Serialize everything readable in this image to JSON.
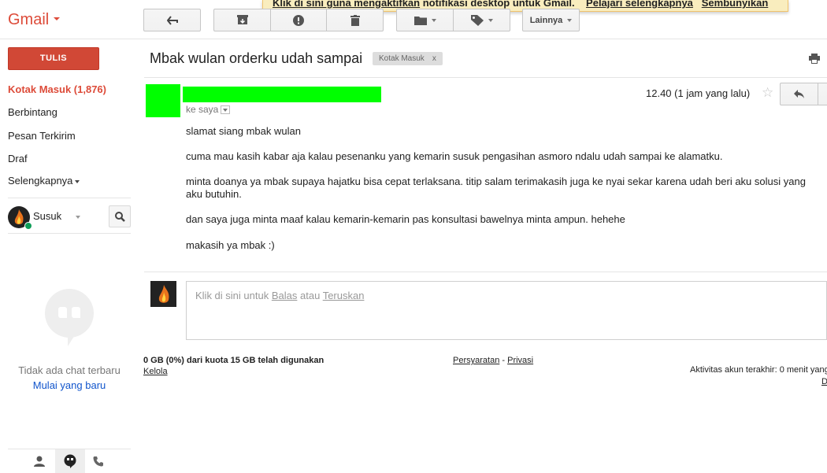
{
  "notification": {
    "link1": "Klik di sini guna mengaktifkan",
    "text": "notifikasi desktop untuk Gmail.",
    "link2": "Pelajari selengkapnya",
    "link3": "Sembunyikan"
  },
  "app": {
    "logo": "Gmail"
  },
  "toolbar": {
    "back_icon": "arrow-left-icon",
    "archive_icon": "archive-icon",
    "spam_icon": "report-spam-icon",
    "delete_icon": "trash-icon",
    "move_icon": "folder-icon",
    "labels_icon": "label-tag-icon",
    "more_label": "Lainnya"
  },
  "sidebar": {
    "compose_label": "TULIS",
    "items": [
      {
        "label": "Kotak Masuk (1,876)",
        "active": true
      },
      {
        "label": "Berbintang"
      },
      {
        "label": "Pesan Terkirim"
      },
      {
        "label": "Draf"
      },
      {
        "label": "Selengkapnya"
      }
    ],
    "user_name": "Susuk",
    "chat_empty": "Tidak ada chat terbaru",
    "chat_start": "Mulai yang baru"
  },
  "message": {
    "subject": "Mbak wulan orderku udah sampai",
    "label_chip": "Kotak Masuk",
    "label_chip_close": "x",
    "to": "ke saya",
    "time": "12.40 (1 jam yang lalu)",
    "body": [
      "slamat siang mbak wulan",
      "cuma mau kasih kabar aja kalau pesenanku yang kemarin susuk pengasihan asmoro ndalu udah sampai ke alamatku.",
      "minta doanya ya mbak supaya hajatku bisa cepat terlaksana. titip salam terimakasih juga ke nyai sekar karena udah beri aku solusi yang aku butuhin.",
      "dan saya juga minta maaf kalau kemarin-kemarin pas konsultasi bawelnya minta ampun. hehehe",
      "makasih ya mbak :)"
    ]
  },
  "reply": {
    "prefix": "Klik di sini untuk",
    "reply_link": "Balas",
    "or": "atau",
    "forward_link": "Teruskan"
  },
  "footer": {
    "quota": "0 GB (0%) dari kuota 15 GB telah digunakan",
    "manage": "Kelola",
    "terms": "Persyaratan",
    "dash": "-",
    "privacy": "Privasi",
    "last_activity": "Aktivitas akun terakhir: 0 menit yang",
    "details": "D"
  },
  "colors": {
    "accent": "#dd4b39",
    "compose": "#d14836",
    "redacted": "#00ff00"
  }
}
